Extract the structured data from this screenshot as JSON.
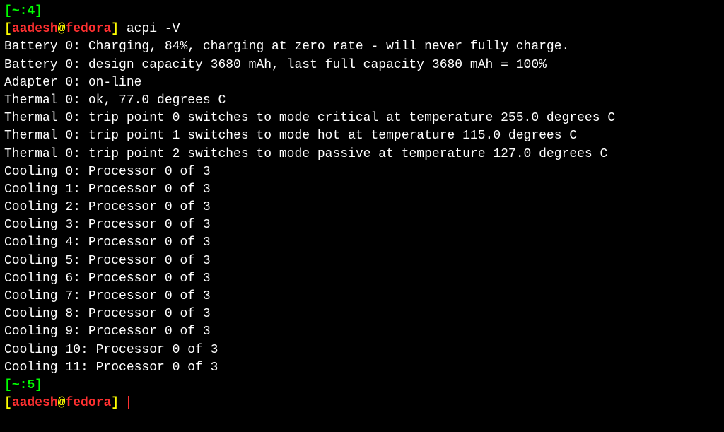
{
  "prompt1": {
    "bracket_open": "[",
    "tilde": "~",
    "colon": ":",
    "number": "4",
    "bracket_close": "]"
  },
  "prompt2": {
    "bracket_open": "[",
    "user": "aadesh",
    "at": "@",
    "host": "fedora",
    "bracket_close": "]",
    "command": " acpi -V"
  },
  "output": {
    "line0": "Battery 0: Charging, 84%, charging at zero rate - will never fully charge.",
    "line1": "Battery 0: design capacity 3680 mAh, last full capacity 3680 mAh = 100%",
    "line2": "Adapter 0: on-line",
    "line3": "Thermal 0: ok, 77.0 degrees C",
    "line4": "Thermal 0: trip point 0 switches to mode critical at temperature 255.0 degrees C",
    "line5": "Thermal 0: trip point 1 switches to mode hot at temperature 115.0 degrees C",
    "line6": "Thermal 0: trip point 2 switches to mode passive at temperature 127.0 degrees C",
    "line7": "Cooling 0: Processor 0 of 3",
    "line8": "Cooling 1: Processor 0 of 3",
    "line9": "Cooling 2: Processor 0 of 3",
    "line10": "Cooling 3: Processor 0 of 3",
    "line11": "Cooling 4: Processor 0 of 3",
    "line12": "Cooling 5: Processor 0 of 3",
    "line13": "Cooling 6: Processor 0 of 3",
    "line14": "Cooling 7: Processor 0 of 3",
    "line15": "Cooling 8: Processor 0 of 3",
    "line16": "Cooling 9: Processor 0 of 3",
    "line17": "Cooling 10: Processor 0 of 3",
    "line18": "Cooling 11: Processor 0 of 3"
  },
  "prompt3": {
    "bracket_open": "[",
    "tilde": "~",
    "colon": ":",
    "number": "5",
    "bracket_close": "]"
  },
  "prompt4": {
    "bracket_open": "[",
    "user": "aadesh",
    "at": "@",
    "host": "fedora",
    "bracket_close": "]",
    "space": " "
  }
}
